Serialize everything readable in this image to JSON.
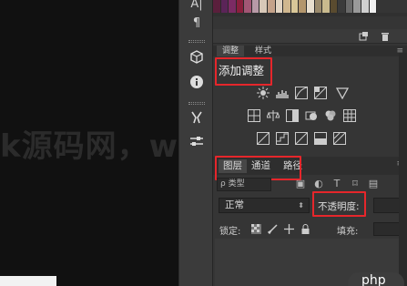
{
  "watermark": {
    "text": "k源码网，www.lsear.c"
  },
  "swatch_colors": [
    "#5a1f3c",
    "#5b2458",
    "#7c2b64",
    "#8a1f3e",
    "#a25675",
    "#b89aa7",
    "#d8c8b8",
    "#c5a28a",
    "#e2d4c3",
    "#d0b78f",
    "#d9c798",
    "#b3966c",
    "#e8dfcf",
    "#9a8a6c",
    "#c9ba8e",
    "#5a4b2f",
    "#3b3b3b",
    "#6a6a6a",
    "#999999",
    "#d0d0d0",
    "#f0f0f0"
  ],
  "adjust_panel": {
    "tabs": [
      {
        "label": "调整"
      },
      {
        "label": "样式"
      }
    ],
    "title": "添加调整",
    "icons_row1": [
      "brightness-icon",
      "levels-icon",
      "curves-icon",
      "exposure-icon",
      "vibrance-icon"
    ],
    "icons_row2": [
      "hue-saturation-icon",
      "color-balance-icon",
      "black-white-icon",
      "photo-filter-icon",
      "channel-mixer-icon",
      "color-lookup-icon"
    ],
    "icons_row3": [
      "invert-icon",
      "posterize-icon",
      "threshold-icon",
      "gradient-map-icon",
      "selective-color-icon"
    ]
  },
  "layers_panel": {
    "tabs": [
      {
        "label": "图层"
      },
      {
        "label": "通道"
      },
      {
        "label": "路径"
      }
    ],
    "filter": {
      "kind": "ρ 类型"
    },
    "blend_mode": "正常",
    "opacity_label": "不透明度:",
    "lock_label": "锁定:",
    "fill_label": "填充:"
  },
  "badge": {
    "text": "php"
  }
}
